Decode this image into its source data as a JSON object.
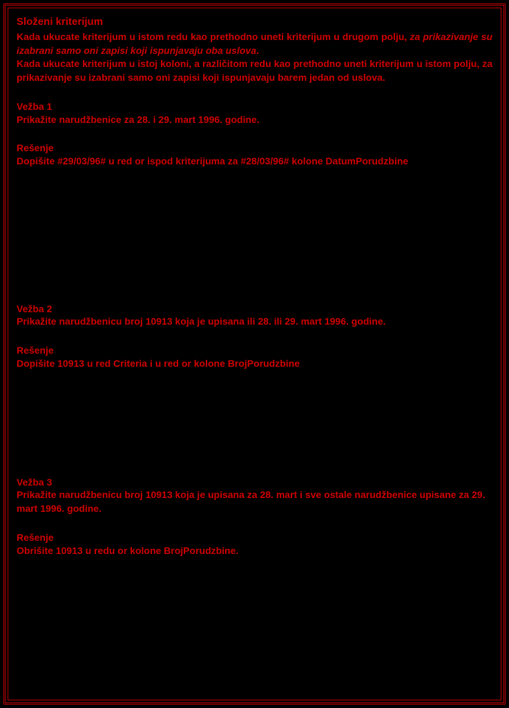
{
  "title": "Složeni kriterijum",
  "intro_row_prefix": "Kada ukucate kriterijum u istom redu kao prethodno uneti  kriterijum u drugom polju, ",
  "intro_row_italic": "za prikazivanje su izabrani samo oni zapisi koji ispunjavaju oba uslova",
  "intro_row_suffix": ".",
  "intro_col_prefix": "Kada ukucate kriterijum u istoj koloni, a različitom redu kao prethodno uneti  kriterijum u istom polju, ",
  "intro_col_bold": "za prikazivanje su izabrani samo oni zapisi koji ispunjavaju barem jedan od uslova.",
  "ex1_heading": "Vežba 1",
  "ex1_body": "Prikažite narudžbenice za 28. i 29. mart 1996.  godine.",
  "sol1_heading": "Rešenje",
  "sol1_body": "Dopišite #29/03/96# u red or ispod kriterijuma za #28/03/96# kolone DatumPorudzbine",
  "ex2_heading": "Vežba 2",
  "ex2_body": "Prikažite narudžbenicu broj 10913 koja je upisana ili 28. ili 29. mart 1996.  godine.",
  "sol2_heading": "Rešenje",
  "sol2_body": "Dopišite 10913 u red Criteria i u red or kolone BrojPorudzbine",
  "ex3_heading": "Vežba 3",
  "ex3_body": "Prikažite narudžbenicu broj 10913 koja je upisana za 28. mart i sve ostale narudžbenice upisane za 29. mart 1996.  godine.",
  "sol3_heading": "Rešenje",
  "sol3_body": "Obrišite 10913 u redu or kolone BrojPorudzbine."
}
